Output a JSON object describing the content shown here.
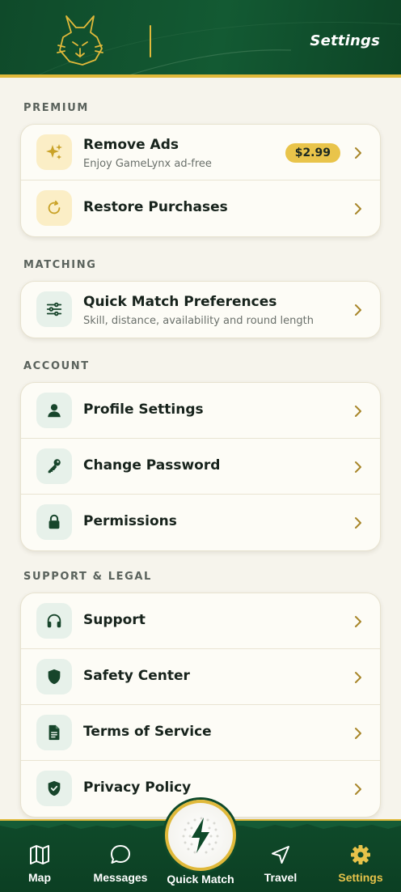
{
  "header": {
    "title": "Settings",
    "logo_icon": "lynx-logo-icon"
  },
  "sections": {
    "premium": {
      "label": "PREMIUM",
      "items": [
        {
          "title": "Remove Ads",
          "subtitle": "Enjoy GameLynx ad-free",
          "badge": "$2.99",
          "icon": "sparkle-icon"
        },
        {
          "title": "Restore Purchases",
          "icon": "refresh-icon"
        }
      ]
    },
    "matching": {
      "label": "MATCHING",
      "items": [
        {
          "title": "Quick Match Preferences",
          "subtitle": "Skill, distance, availability and round length",
          "icon": "sliders-icon"
        }
      ]
    },
    "account": {
      "label": "ACCOUNT",
      "items": [
        {
          "title": "Profile Settings",
          "icon": "user-icon"
        },
        {
          "title": "Change Password",
          "icon": "key-icon"
        },
        {
          "title": "Permissions",
          "icon": "lock-icon"
        }
      ]
    },
    "support": {
      "label": "SUPPORT & LEGAL",
      "items": [
        {
          "title": "Support",
          "icon": "headphones-icon"
        },
        {
          "title": "Safety Center",
          "icon": "shield-icon"
        },
        {
          "title": "Terms of Service",
          "icon": "document-icon"
        },
        {
          "title": "Privacy Policy",
          "icon": "shield-check-icon"
        }
      ]
    }
  },
  "nav": {
    "items": [
      {
        "label": "Map",
        "icon": "map-icon"
      },
      {
        "label": "Messages",
        "icon": "chat-icon"
      },
      {
        "label": "Quick Match",
        "icon": "lightning-icon"
      },
      {
        "label": "Travel",
        "icon": "navigation-arrow-icon"
      },
      {
        "label": "Settings",
        "icon": "gear-icon",
        "active": true
      }
    ]
  },
  "colors": {
    "brand_green": "#0f4a2a",
    "accent_gold": "#e0b93a",
    "background": "#f6f4ec",
    "active_nav": "#e7c34a"
  }
}
